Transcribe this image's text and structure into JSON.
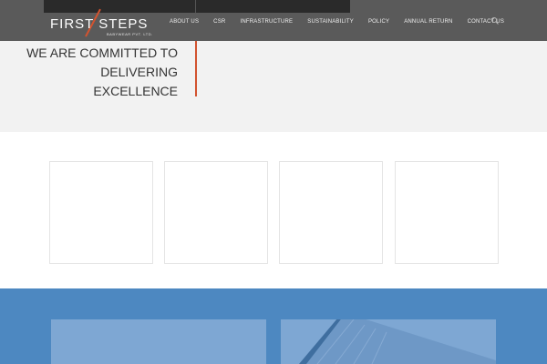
{
  "logo": {
    "text": "FIRST STEPS",
    "subtext": "BABYWEAR PVT. LTD."
  },
  "nav": {
    "items": [
      "ABOUT US",
      "CSR",
      "INFRASTRUCTURE",
      "SUSTAINABILITY",
      "POLICY",
      "ANNUAL RETURN",
      "CONTACT US"
    ]
  },
  "icons": {
    "search": "search-icon"
  },
  "hero": {
    "line1": "WE ARE COMMITTED TO",
    "line2": "DELIVERING",
    "line3": "EXCELLENCE"
  },
  "colors": {
    "accent": "#d2532f",
    "header": "#5a5a5a",
    "band": "#4d88c1"
  }
}
